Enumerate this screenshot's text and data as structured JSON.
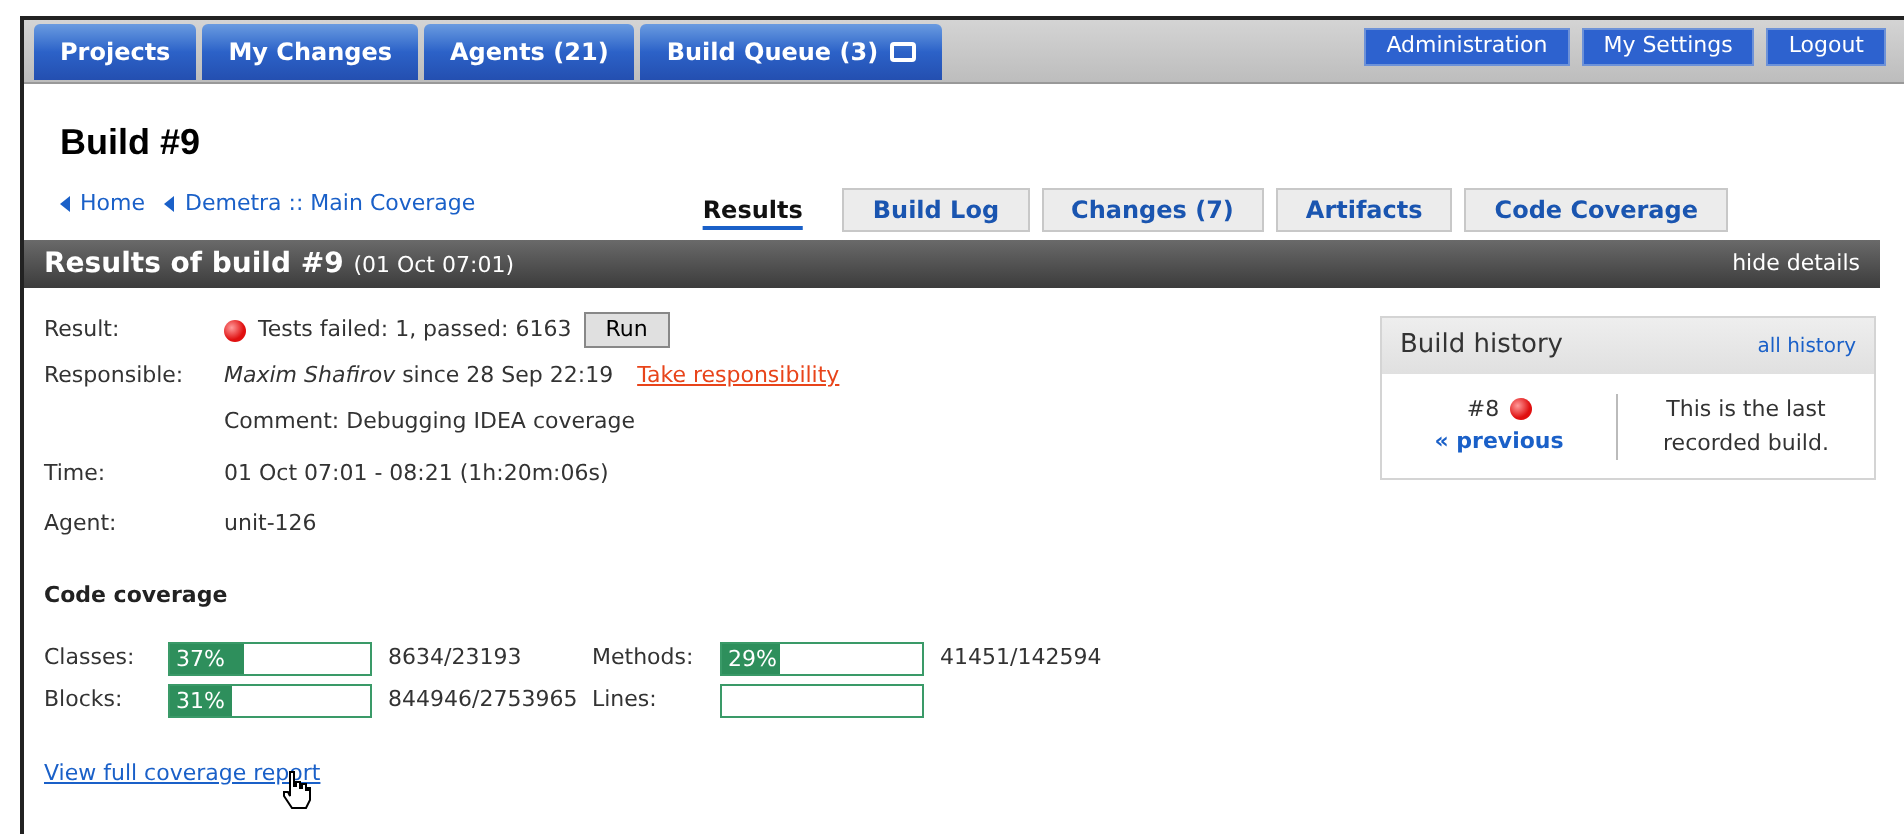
{
  "nav": {
    "left": [
      {
        "label": "Projects",
        "icon": false
      },
      {
        "label": "My Changes",
        "icon": false
      },
      {
        "label": "Agents (21)",
        "icon": false
      },
      {
        "label": "Build Queue (3)",
        "icon": true
      }
    ],
    "right": [
      "Administration",
      "My Settings",
      "Logout"
    ]
  },
  "page": {
    "title": "Build #9",
    "breadcrumbs": [
      "Home",
      "Demetra :: Main Coverage"
    ]
  },
  "tabs": [
    {
      "label": "Results",
      "selected": true
    },
    {
      "label": "Build Log",
      "selected": false
    },
    {
      "label": "Changes (7)",
      "selected": false
    },
    {
      "label": "Artifacts",
      "selected": false
    },
    {
      "label": "Code Coverage",
      "selected": false
    }
  ],
  "results_bar": {
    "title": "Results of build #9",
    "date": "(01 Oct 07:01)",
    "toggle": "hide details"
  },
  "details": {
    "result_label": "Result:",
    "result_failed": true,
    "result_text": "Tests failed: 1, passed: 6163",
    "run_button": "Run",
    "responsible_label": "Responsible:",
    "responsible_name": "Maxim Shafirov",
    "responsible_since": "since 28 Sep 22:19",
    "take_link": "Take responsibility",
    "comment": "Comment: Debugging IDEA coverage",
    "time_label": "Time:",
    "time": "01 Oct 07:01 - 08:21 (1h:20m:06s)",
    "agent_label": "Agent:",
    "agent": "unit-126"
  },
  "build_history": {
    "title": "Build history",
    "all_link": "all history",
    "prev_build": "#8",
    "prev_failed": true,
    "prev_link": "« previous",
    "note": "This is the last recorded build."
  },
  "coverage": {
    "title": "Code coverage",
    "metrics": [
      {
        "label": "Classes:",
        "percent": "37%",
        "level": 0.37,
        "count": "8634/23193"
      },
      {
        "label": "Methods:",
        "percent": "29%",
        "level": 0.29,
        "count": "41451/142594"
      },
      {
        "label": "Blocks:",
        "percent": "31%",
        "level": 0.31,
        "count": "844946/2753965"
      },
      {
        "label": "Lines:"
      }
    ],
    "report_link": "View full coverage report"
  }
}
